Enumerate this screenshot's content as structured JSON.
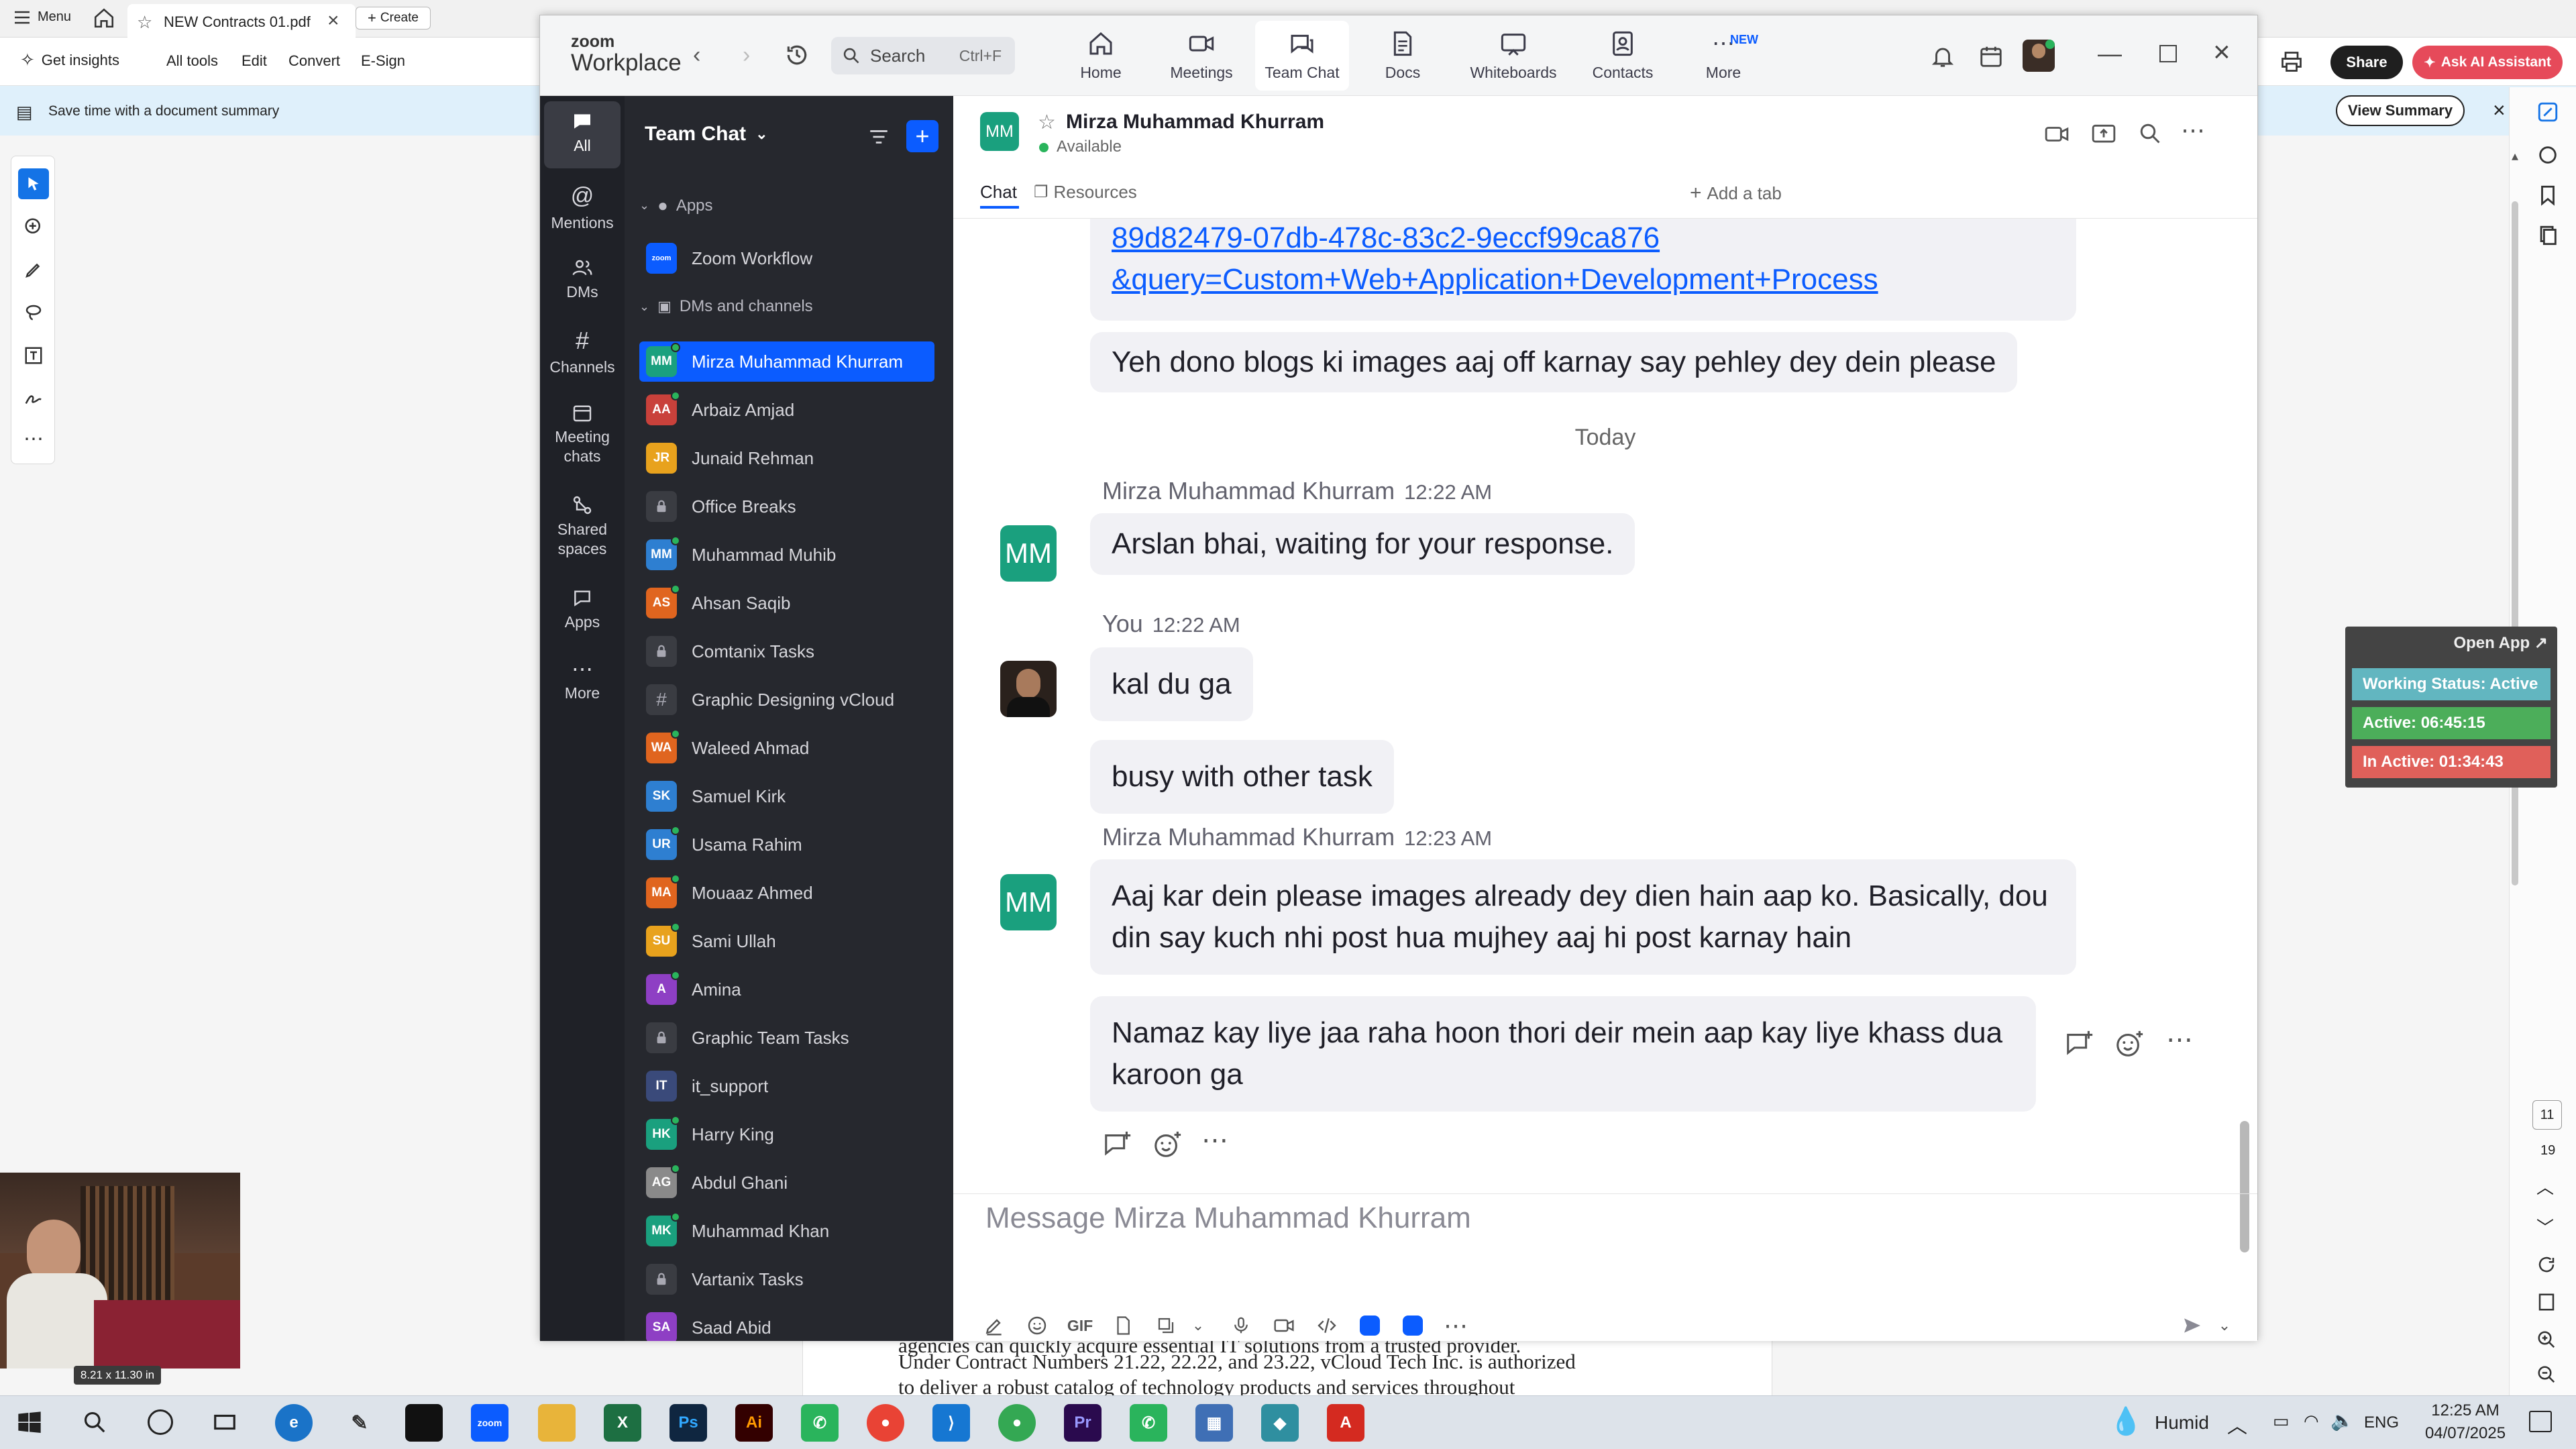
{
  "pdf": {
    "menu": "Menu",
    "tab_title": "NEW Contracts 01.pdf",
    "create": "Create",
    "toolbar": {
      "get_insights": "Get insights",
      "all_tools": "All tools",
      "edit": "Edit",
      "convert": "Convert",
      "esign": "E-Sign"
    },
    "share": "Share",
    "ai_assistant": "Ask AI Assistant",
    "banner_text": "Save time with a document summary",
    "view_summary": "View Summary",
    "page_lines": [
      "agencies can quickly acquire essential IT solutions from a trusted provider.",
      "Under Contract Numbers 21.22, 22.22, and 23.22, vCloud Tech Inc. is authorized",
      "to deliver a robust catalog of technology products and services throughout"
    ],
    "video_size": "8.21 x 11.30 in",
    "page_number": "11",
    "page_total": "19"
  },
  "timer": {
    "open_app": "Open App ↗",
    "working_status": "Working Status: Active",
    "active": "Active: 06:45:15",
    "inactive": "In Active: 01:34:43"
  },
  "zoom": {
    "brand_top": "zoom",
    "brand_bottom": "Workplace",
    "search_placeholder": "Search",
    "search_shortcut": "Ctrl+F",
    "nav": [
      {
        "label": "Home",
        "icon": "home-icon"
      },
      {
        "label": "Meetings",
        "icon": "video-icon"
      },
      {
        "label": "Team Chat",
        "icon": "chat-icon"
      },
      {
        "label": "Docs",
        "icon": "docs-icon"
      },
      {
        "label": "Whiteboards",
        "icon": "whiteboard-icon"
      },
      {
        "label": "Contacts",
        "icon": "contacts-icon"
      },
      {
        "label": "More",
        "icon": "more-icon",
        "badge": "NEW"
      }
    ],
    "rail": [
      "All",
      "Mentions",
      "DMs",
      "Channels",
      "Meeting chats",
      "Shared spaces",
      "Apps",
      "More"
    ],
    "sidebar": {
      "title": "Team Chat",
      "apps_header": "Apps",
      "apps": [
        {
          "name": "Zoom Workflow",
          "badge": "zoom"
        }
      ],
      "dm_header": "DMs and channels",
      "items": [
        {
          "name": "Mirza Muhammad Khurram",
          "initials": "MM",
          "color": "#1aa07e",
          "online": true
        },
        {
          "name": "Arbaiz Amjad",
          "initials": "AA",
          "color": "#c9413b",
          "online": true
        },
        {
          "name": "Junaid Rehman",
          "initials": "JR",
          "color": "#e8a21d",
          "online": false
        },
        {
          "name": "Office Breaks",
          "initials": "lock",
          "color": "#3a3c42",
          "online": false
        },
        {
          "name": "Muhammad Muhib",
          "initials": "MM",
          "color": "#2e7fd1",
          "online": true
        },
        {
          "name": "Ahsan Saqib",
          "initials": "AS",
          "color": "#e0651f",
          "online": true
        },
        {
          "name": "Comtanix Tasks",
          "initials": "lock",
          "color": "#3a3c42",
          "online": false
        },
        {
          "name": "Graphic Designing vCloud",
          "initials": "#",
          "color": "#3a3c42",
          "online": false
        },
        {
          "name": "Waleed Ahmad",
          "initials": "WA",
          "color": "#e0651f",
          "online": true
        },
        {
          "name": "Samuel Kirk",
          "initials": "SK",
          "color": "#2e7fd1",
          "online": false
        },
        {
          "name": "Usama Rahim",
          "initials": "UR",
          "color": "#2e7fd1",
          "online": true
        },
        {
          "name": "Mouaaz Ahmed",
          "initials": "MA",
          "color": "#e0651f",
          "online": true
        },
        {
          "name": "Sami Ullah",
          "initials": "SU",
          "color": "#e8a21d",
          "online": true
        },
        {
          "name": "Amina",
          "initials": "A",
          "color": "#8e3fc4",
          "online": true
        },
        {
          "name": "Graphic Team Tasks",
          "initials": "lock",
          "color": "#3a3c42",
          "online": false
        },
        {
          "name": "it_support",
          "initials": "IT",
          "color": "#3a4a7a",
          "online": false
        },
        {
          "name": "Harry King",
          "initials": "HK",
          "color": "#1aa07e",
          "online": true
        },
        {
          "name": "Abdul Ghani",
          "initials": "AG",
          "color": "#8a8a8a",
          "online": true
        },
        {
          "name": "Muhammad Khan",
          "initials": "MK",
          "color": "#1aa07e",
          "online": true
        },
        {
          "name": "Vartanix Tasks",
          "initials": "lock",
          "color": "#3a3c42",
          "online": false
        },
        {
          "name": "Saad Abid",
          "initials": "SA",
          "color": "#8e3fc4",
          "online": false
        }
      ]
    },
    "chat": {
      "contact_initials": "MM",
      "contact_name": "Mirza Muhammad Khurram",
      "status": "Available",
      "tabs": [
        "Chat",
        "Resources",
        "Add a tab"
      ],
      "link_line1": "89d82479-07db-478c-83c2-9eccf99ca876",
      "link_line2": "&query=Custom+Web+Application+Development+Process",
      "earlier_msg": "Yeh dono blogs ki images aaj off karnay say pehley dey dein please",
      "day_divider": "Today",
      "groups": [
        {
          "sender": "Mirza Muhammad Khurram",
          "time": "12:22 AM",
          "messages": [
            "Arslan bhai, waiting for your response."
          ]
        },
        {
          "sender": "You",
          "time": "12:22 AM",
          "messages": [
            "kal du ga",
            "busy with other task"
          ]
        },
        {
          "sender": "Mirza Muhammad Khurram",
          "time": "12:23 AM",
          "messages": [
            "Aaj kar dein please images already dey dien hain aap ko. Basically, dou din say kuch nhi post hua mujhey aaj hi post karnay hain",
            "Namaz kay liye jaa raha hoon thori deir mein aap kay liye khass dua karoon ga"
          ]
        }
      ],
      "composer_placeholder": "Message Mirza Muhammad Khurram",
      "gif": "GIF"
    }
  },
  "taskbar": {
    "weather": "Humid",
    "lang": "ENG",
    "time": "12:25 AM",
    "date": "04/07/2025",
    "apps": [
      "Ps",
      "Ai",
      "Pr"
    ]
  }
}
